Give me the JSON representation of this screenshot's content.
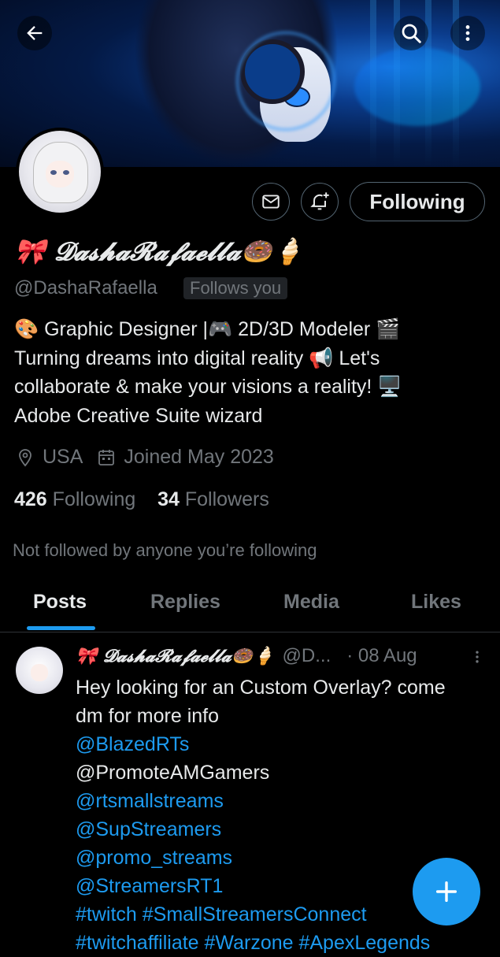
{
  "profile": {
    "display_name": "🎀 𝓓𝓪𝓼𝓱𝓪𝓡𝓪𝓯𝓪𝓮𝓵𝓵𝓪🍩🍦",
    "handle": "@DashaRafaella",
    "follows_you_badge": "Follows you",
    "bio_lines": [
      "🎨 Graphic Designer |🎮 2D/3D Modeler 🎬",
      "Turning dreams into digital reality 📢 Let's",
      "collaborate & make your visions a reality! 🖥️",
      "Adobe Creative Suite wizard"
    ],
    "location": "USA",
    "joined": "Joined May 2023",
    "following_count": "426",
    "following_label": "Following",
    "followers_count": "34",
    "followers_label": "Followers",
    "not_followed_text": "Not followed by anyone you’re following"
  },
  "actions": {
    "follow_button_label": "Following"
  },
  "tabs": [
    {
      "label": "Posts",
      "active": true
    },
    {
      "label": "Replies",
      "active": false
    },
    {
      "label": "Media",
      "active": false
    },
    {
      "label": "Likes",
      "active": false
    }
  ],
  "post": {
    "author_name": "🎀 𝓓𝓪𝓼𝓱𝓪𝓡𝓪𝓯𝓪𝓮𝓵𝓵𝓪🍩🍦",
    "author_handle": "@D...",
    "date": "· 08 Aug",
    "text_lines": [
      {
        "text": "Hey looking for an Custom Overlay? come",
        "link": false
      },
      {
        "text": "dm for more info",
        "link": false
      },
      {
        "text": "@BlazedRTs",
        "link": true
      },
      {
        "text": "@PromoteAMGamers",
        "link": false
      },
      {
        "text": "@rtsmallstreams",
        "link": true
      },
      {
        "text": "@SupStreamers",
        "link": true
      },
      {
        "text": "@promo_streams",
        "link": true
      },
      {
        "text": "@StreamersRT1",
        "link": true
      },
      {
        "text": "#twitch #SmallStreamersConnect",
        "link": true
      },
      {
        "text": "#twitchaffiliate #Warzone #ApexLegends",
        "link": true
      }
    ]
  },
  "icons": {
    "back": "arrow-left-icon",
    "search": "search-icon",
    "more": "more-vertical-icon",
    "message": "mail-icon",
    "notify": "bell-plus-icon",
    "location": "location-pin-icon",
    "calendar": "calendar-icon",
    "compose": "plus-icon"
  },
  "colors": {
    "accent": "#1d9bf0",
    "secondary_text": "#71767b",
    "primary_text": "#e7e9ea",
    "background": "#000000"
  }
}
